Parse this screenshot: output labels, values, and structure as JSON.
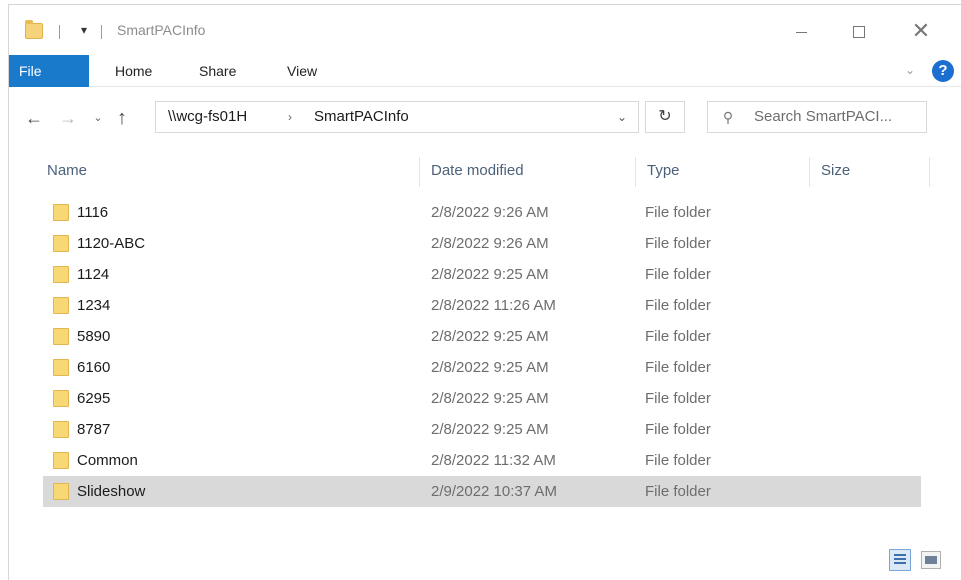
{
  "window": {
    "title": "SmartPACInfo",
    "controls": {
      "minimize_icon": "minimize-icon",
      "maximize_icon": "maximize-icon",
      "close_icon": "close-icon"
    }
  },
  "ribbon": {
    "tabs": [
      "File",
      "Home",
      "Share",
      "View"
    ],
    "help_label": "?"
  },
  "address": {
    "crumbs": [
      "\\\\wcg-fs01H",
      "SmartPACInfo"
    ],
    "separator": "›"
  },
  "search": {
    "placeholder": "Search SmartPACI..."
  },
  "columns": {
    "name": "Name",
    "date": "Date modified",
    "type": "Type",
    "size": "Size"
  },
  "files": [
    {
      "name": "1116",
      "date": "2/8/2022 9:26 AM",
      "type": "File folder"
    },
    {
      "name": "1120-ABC",
      "date": "2/8/2022 9:26 AM",
      "type": "File folder"
    },
    {
      "name": "1124",
      "date": "2/8/2022 9:25 AM",
      "type": "File folder"
    },
    {
      "name": "1234",
      "date": "2/8/2022 11:26 AM",
      "type": "File folder"
    },
    {
      "name": "5890",
      "date": "2/8/2022 9:25 AM",
      "type": "File folder"
    },
    {
      "name": "6160",
      "date": "2/8/2022 9:25 AM",
      "type": "File folder"
    },
    {
      "name": "6295",
      "date": "2/8/2022 9:25 AM",
      "type": "File folder"
    },
    {
      "name": "8787",
      "date": "2/8/2022 9:25 AM",
      "type": "File folder"
    },
    {
      "name": "Common",
      "date": "2/8/2022 11:32 AM",
      "type": "File folder"
    },
    {
      "name": "Slideshow",
      "date": "2/9/2022 10:37 AM",
      "type": "File folder"
    }
  ],
  "colors": {
    "file_tab": "#1979ca",
    "selected_row": "#d9d9d9",
    "folder": "#f8d775"
  }
}
